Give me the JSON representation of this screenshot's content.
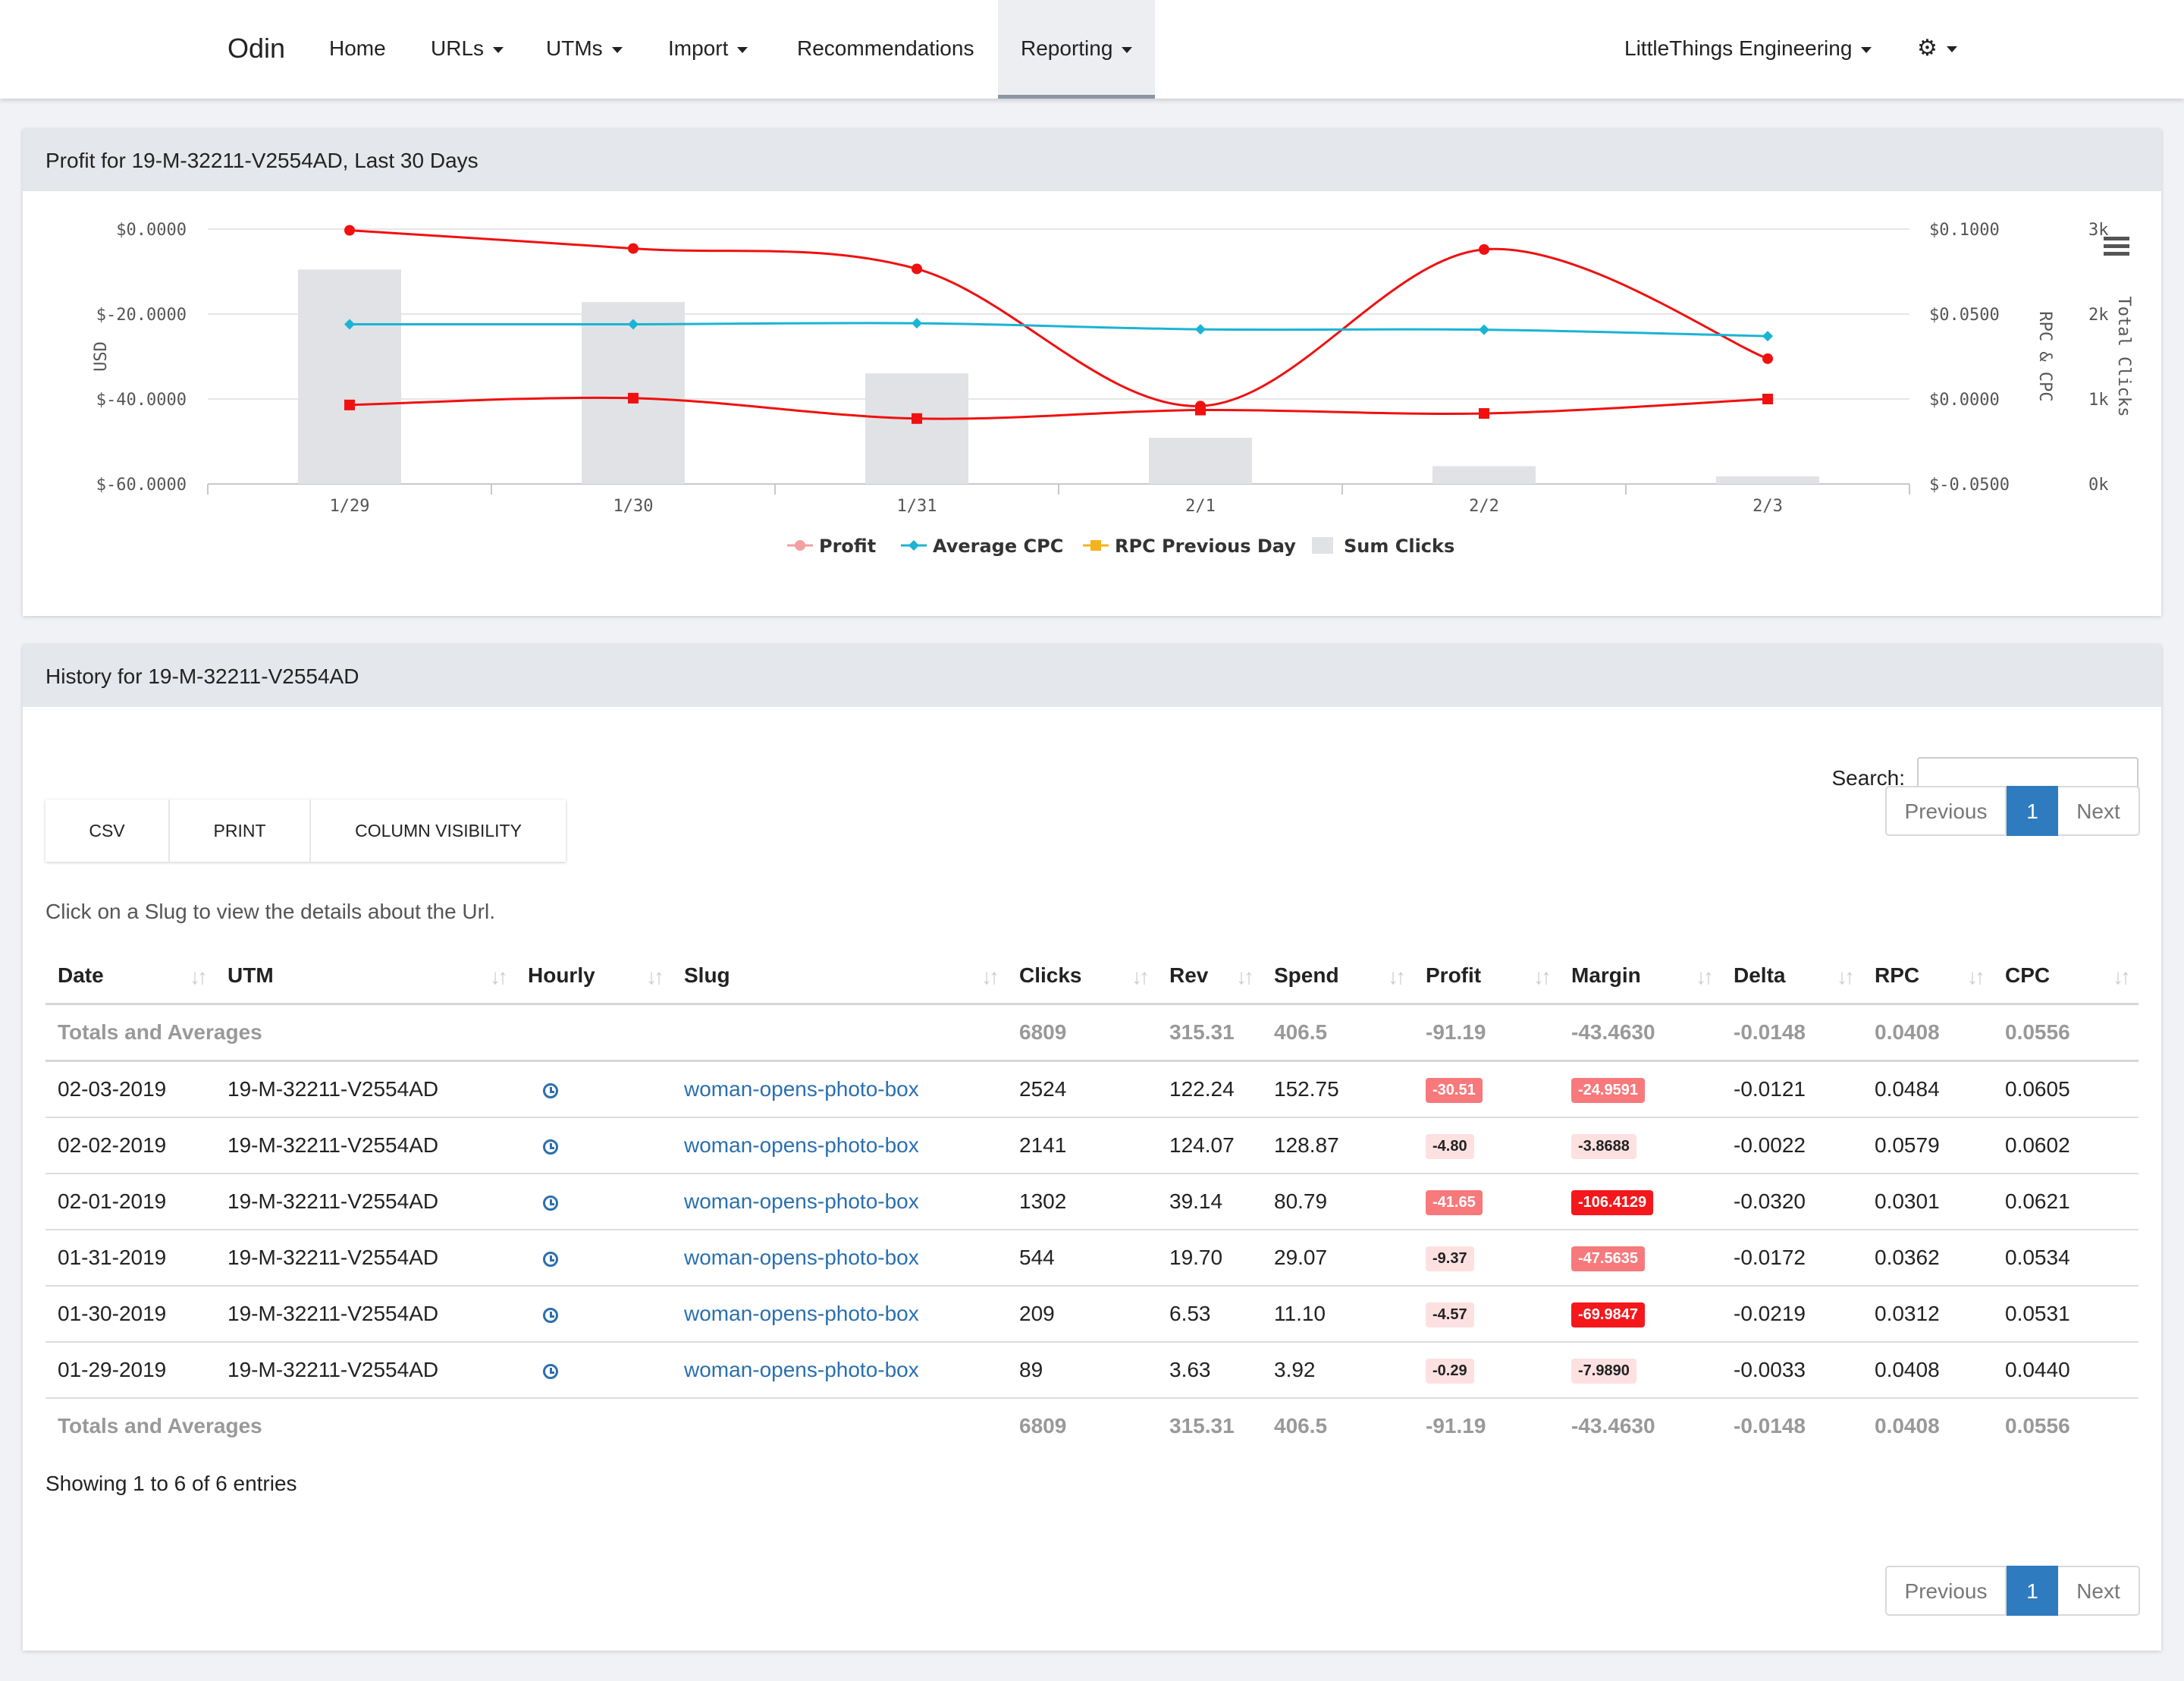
{
  "nav": {
    "brand": "Odin",
    "items": [
      {
        "label": "Home",
        "dropdown": false
      },
      {
        "label": "URLs",
        "dropdown": true
      },
      {
        "label": "UTMs",
        "dropdown": true
      },
      {
        "label": "Import",
        "dropdown": true
      },
      {
        "label": "Recommendations",
        "dropdown": false
      },
      {
        "label": "Reporting",
        "dropdown": true,
        "active": true
      }
    ],
    "org": "LittleThings Engineering",
    "settings_icon": "gear-icon"
  },
  "profit_panel": {
    "title": "Profit for 19-M-32211-V2554AD, Last 30 Days",
    "menu_icon": "hamburger-icon"
  },
  "chart_data": {
    "type": "line",
    "categories": [
      "1/29",
      "1/30",
      "1/31",
      "2/1",
      "2/2",
      "2/3"
    ],
    "axes": {
      "left": {
        "label": "USD",
        "ticks": [
          "$0.0000",
          "$-20.0000",
          "$-40.0000",
          "$-60.0000"
        ],
        "range": [
          -60,
          0
        ]
      },
      "right1": {
        "label": "RPC & CPC",
        "ticks": [
          "$0.1000",
          "$0.0500",
          "$0.0000",
          "$-0.0500"
        ],
        "range": [
          -0.05,
          0.1
        ]
      },
      "right2": {
        "label": "Total Clicks",
        "ticks": [
          "3k",
          "2k",
          "1k",
          "0k"
        ],
        "range": [
          0,
          3000
        ]
      }
    },
    "series": [
      {
        "name": "Profit",
        "type": "line",
        "axis": "left",
        "marker": "circle",
        "color": "#f01010",
        "values": [
          -0.29,
          -4.57,
          -9.37,
          -41.65,
          -4.8,
          -30.51
        ]
      },
      {
        "name": "Average CPC",
        "type": "line",
        "axis": "right1",
        "marker": "diamond",
        "color": "#1ab4d4",
        "values": [
          0.044,
          0.044,
          0.0446,
          0.041,
          0.0408,
          0.037
        ]
      },
      {
        "name": "RPC Previous Day",
        "type": "line",
        "axis": "right1",
        "marker": "square",
        "color": "#f01010",
        "legend_color": "#f6b21c",
        "values": [
          -0.0035,
          0.0005,
          -0.0115,
          -0.0065,
          -0.0085,
          0.0
        ]
      },
      {
        "name": "Sum Clicks",
        "type": "bar",
        "axis": "right2",
        "color": "#e1e2e5",
        "values": [
          2524,
          2141,
          1302,
          544,
          209,
          89
        ]
      }
    ],
    "legend_position": "bottom-center",
    "grid": true
  },
  "history_panel": {
    "title": "History for 19-M-32211-V2554AD",
    "search_label": "Search:",
    "search_value": "",
    "pagination": {
      "previous": "Previous",
      "current": "1",
      "next": "Next"
    },
    "buttons": [
      "CSV",
      "PRINT",
      "COLUMN VISIBILITY"
    ],
    "hint": "Click on a Slug to view the details about the Url.",
    "columns": [
      "Date",
      "UTM",
      "Hourly",
      "Slug",
      "Clicks",
      "Rev",
      "Spend",
      "Profit",
      "Margin",
      "Delta",
      "RPC",
      "CPC"
    ],
    "totals": {
      "label": "Totals and Averages",
      "clicks": "6809",
      "rev": "315.31",
      "spend": "406.5",
      "profit": "-91.19",
      "margin": "-43.4630",
      "delta": "-0.0148",
      "rpc": "0.0408",
      "cpc": "0.0556"
    },
    "rows": [
      {
        "date": "02-03-2019",
        "utm": "19-M-32211-V2554AD",
        "slug": "woman-opens-photo-box",
        "clicks": "2524",
        "rev": "122.24",
        "spend": "152.75",
        "profit": "-30.51",
        "profit_level": "mid",
        "margin": "-24.9591",
        "margin_level": "mid",
        "delta": "-0.0121",
        "rpc": "0.0484",
        "cpc": "0.0605"
      },
      {
        "date": "02-02-2019",
        "utm": "19-M-32211-V2554AD",
        "slug": "woman-opens-photo-box",
        "clicks": "2141",
        "rev": "124.07",
        "spend": "128.87",
        "profit": "-4.80",
        "profit_level": "light",
        "margin": "-3.8688",
        "margin_level": "light",
        "delta": "-0.0022",
        "rpc": "0.0579",
        "cpc": "0.0602"
      },
      {
        "date": "02-01-2019",
        "utm": "19-M-32211-V2554AD",
        "slug": "woman-opens-photo-box",
        "clicks": "1302",
        "rev": "39.14",
        "spend": "80.79",
        "profit": "-41.65",
        "profit_level": "mid",
        "margin": "-106.4129",
        "margin_level": "dark",
        "delta": "-0.0320",
        "rpc": "0.0301",
        "cpc": "0.0621"
      },
      {
        "date": "01-31-2019",
        "utm": "19-M-32211-V2554AD",
        "slug": "woman-opens-photo-box",
        "clicks": "544",
        "rev": "19.70",
        "spend": "29.07",
        "profit": "-9.37",
        "profit_level": "light",
        "margin": "-47.5635",
        "margin_level": "mid",
        "delta": "-0.0172",
        "rpc": "0.0362",
        "cpc": "0.0534"
      },
      {
        "date": "01-30-2019",
        "utm": "19-M-32211-V2554AD",
        "slug": "woman-opens-photo-box",
        "clicks": "209",
        "rev": "6.53",
        "spend": "11.10",
        "profit": "-4.57",
        "profit_level": "light",
        "margin": "-69.9847",
        "margin_level": "dark",
        "delta": "-0.0219",
        "rpc": "0.0312",
        "cpc": "0.0531"
      },
      {
        "date": "01-29-2019",
        "utm": "19-M-32211-V2554AD",
        "slug": "woman-opens-photo-box",
        "clicks": "89",
        "rev": "3.63",
        "spend": "3.92",
        "profit": "-0.29",
        "profit_level": "light",
        "margin": "-7.9890",
        "margin_level": "light",
        "delta": "-0.0033",
        "rpc": "0.0408",
        "cpc": "0.0440"
      }
    ],
    "showing": "Showing 1 to 6 of 6 entries"
  }
}
